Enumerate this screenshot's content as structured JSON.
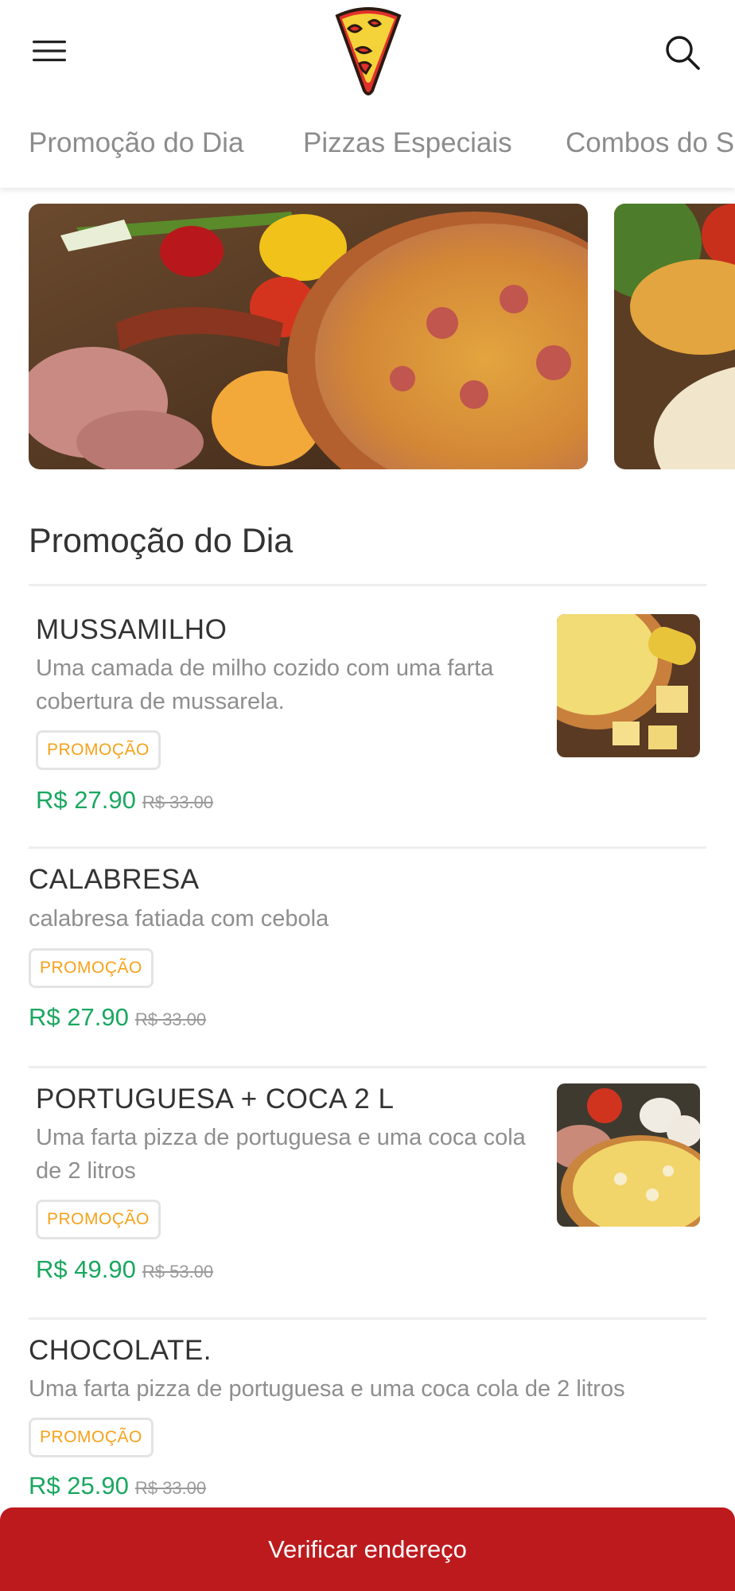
{
  "colors": {
    "accent_green": "#1aa760",
    "promo_orange": "#f5a21b",
    "cta_red": "#bd1a1d"
  },
  "header": {
    "menu_icon": "hamburger-menu-icon",
    "logo": "seu-ze-logo",
    "search_icon": "search-icon"
  },
  "tabs": [
    {
      "label": "Promoção do Dia"
    },
    {
      "label": "Pizzas Especiais"
    },
    {
      "label": "Combos do S"
    }
  ],
  "section": {
    "title": "Promoção do Dia"
  },
  "products": [
    {
      "name": "MUSSAMILHO",
      "description": "Uma camada de milho cozido com uma farta cobertura de mussarela.",
      "badge": "PROMOÇÃO",
      "price": "R$ 27.90",
      "old_price": "R$ 33.00",
      "has_image": true
    },
    {
      "name": "CALABRESA",
      "description": "calabresa fatiada com cebola",
      "badge": "PROMOÇÃO",
      "price": "R$ 27.90",
      "old_price": "R$ 33.00",
      "has_image": false
    },
    {
      "name": "PORTUGUESA + COCA 2 L",
      "description": "Uma farta pizza de portuguesa e uma coca cola de 2 litros",
      "badge": "PROMOÇÃO",
      "price": "R$ 49.90",
      "old_price": "R$ 53.00",
      "has_image": true
    },
    {
      "name": "CHOCOLATE.",
      "description": "Uma farta pizza de portuguesa e uma coca cola de 2 litros",
      "badge": "PROMOÇÃO",
      "price": "R$ 25.90",
      "old_price": "R$ 33.00",
      "has_image": false
    }
  ],
  "bottom_bar": {
    "label": "Verificar endereço"
  }
}
